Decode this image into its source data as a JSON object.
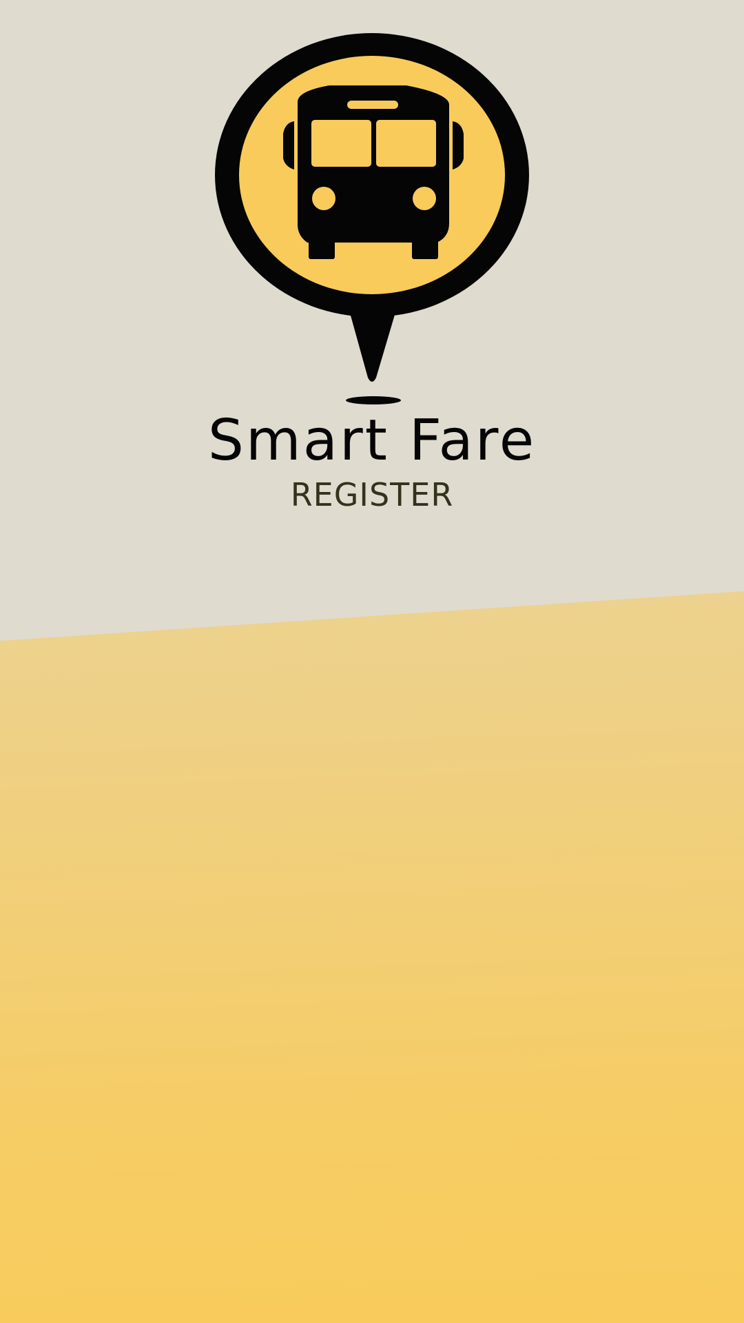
{
  "app": {
    "name": "Smart Fare",
    "screen_title": "REGISTER"
  },
  "logo": {
    "icon": "bus-location-pin-icon"
  },
  "colors": {
    "background_top": "#dfdbcf",
    "background_bottom": "#f9cb5b",
    "logo_fill": "#f9cb5b",
    "logo_outline": "#050505",
    "title_text": "#050505",
    "subtitle_text": "#33321c"
  }
}
